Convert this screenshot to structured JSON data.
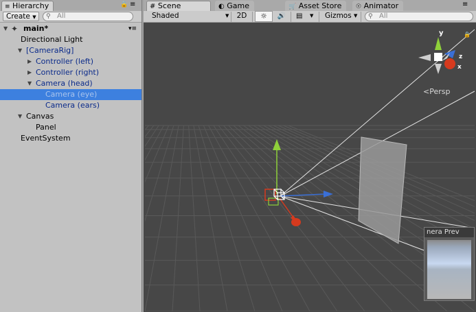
{
  "hierarchy": {
    "tab_label": "Hierarchy",
    "create_label": "Create",
    "search_placeholder": "All",
    "scene_name": "main*",
    "items": [
      {
        "label": "Directional Light",
        "depth": 1,
        "expander": "none",
        "blue": false,
        "selected": false
      },
      {
        "label": "[CameraRig]",
        "depth": 1,
        "expander": "open",
        "blue": true,
        "selected": false
      },
      {
        "label": "Controller (left)",
        "depth": 2,
        "expander": "closed",
        "blue": true,
        "selected": false
      },
      {
        "label": "Controller (right)",
        "depth": 2,
        "expander": "closed",
        "blue": true,
        "selected": false
      },
      {
        "label": "Camera (head)",
        "depth": 2,
        "expander": "open",
        "blue": true,
        "selected": false
      },
      {
        "label": "Camera (eye)",
        "depth": 3,
        "expander": "none",
        "blue": true,
        "selected": true
      },
      {
        "label": "Camera (ears)",
        "depth": 3,
        "expander": "none",
        "blue": true,
        "selected": false
      },
      {
        "label": "Canvas",
        "depth": 1,
        "expander": "open",
        "blue": false,
        "selected": false
      },
      {
        "label": "Panel",
        "depth": 2,
        "expander": "none",
        "blue": false,
        "selected": false
      },
      {
        "label": "EventSystem",
        "depth": 1,
        "expander": "none",
        "blue": false,
        "selected": false
      }
    ]
  },
  "scene_tabs": [
    "Scene",
    "Game",
    "Asset Store",
    "Animator"
  ],
  "scene_toolbar": {
    "shading": "Shaded",
    "mode_2d": "2D",
    "gizmos": "Gizmos",
    "search_placeholder": "All"
  },
  "gizmo": {
    "y": "y",
    "x": "x",
    "z": "z",
    "projection": "Persp"
  },
  "camera_preview_label": "nera Prev",
  "colors": {
    "selection": "#3d80df",
    "scene_bg": "#474747",
    "panel_bg": "#c2c2c2",
    "x_axis": "#d63a1e",
    "y_axis": "#8fd13a",
    "z_axis": "#3a6fd6"
  }
}
